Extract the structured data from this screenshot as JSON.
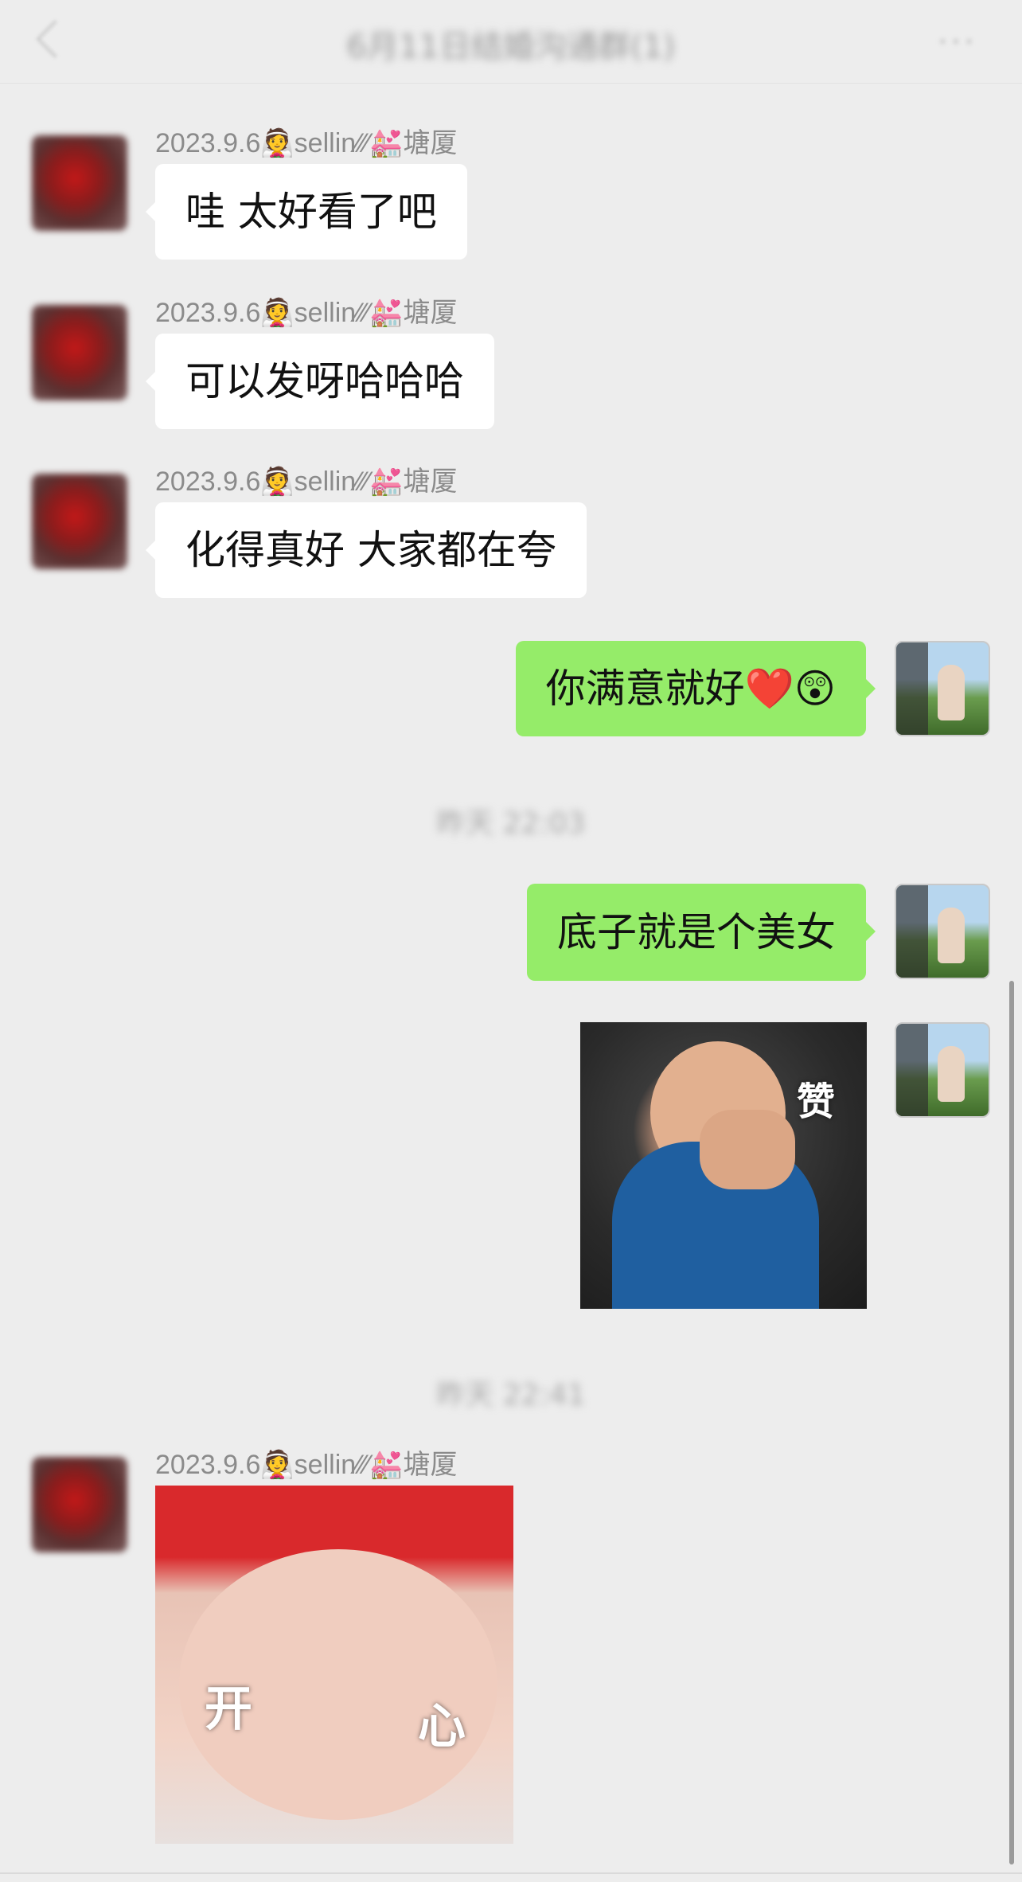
{
  "header": {
    "title": "6月11日结婚沟通群(1)",
    "back_icon": "chevron-left-icon",
    "more_icon": "more-dots-icon",
    "more_glyph": "···"
  },
  "messages": [
    {
      "direction": "in",
      "sender": "2023.9.6👰sellin⁄⁄⁄💒塘厦",
      "text": "哇 太好看了吧"
    },
    {
      "direction": "in",
      "sender": "2023.9.6👰sellin⁄⁄⁄💒塘厦",
      "text": "可以发呀哈哈哈"
    },
    {
      "direction": "in",
      "sender": "2023.9.6👰sellin⁄⁄⁄💒塘厦",
      "text": "化得真好 大家都在夸"
    },
    {
      "direction": "out",
      "text": "你满意就好❤️😲"
    },
    {
      "type": "timestamp",
      "text": "昨天 22:03"
    },
    {
      "direction": "out",
      "text": "底子就是个美女"
    },
    {
      "direction": "out",
      "type": "sticker",
      "sticker_text": "赞"
    },
    {
      "type": "timestamp",
      "text": "昨天 22:41"
    },
    {
      "direction": "in",
      "sender": "2023.9.6👰sellin⁄⁄⁄💒塘厦",
      "type": "sticker",
      "sticker_text_1": "开",
      "sticker_text_2": "心"
    }
  ],
  "colors": {
    "background": "#ededed",
    "bubble_in": "#ffffff",
    "bubble_out": "#95ec69",
    "sender_text": "#8b8b8b"
  }
}
